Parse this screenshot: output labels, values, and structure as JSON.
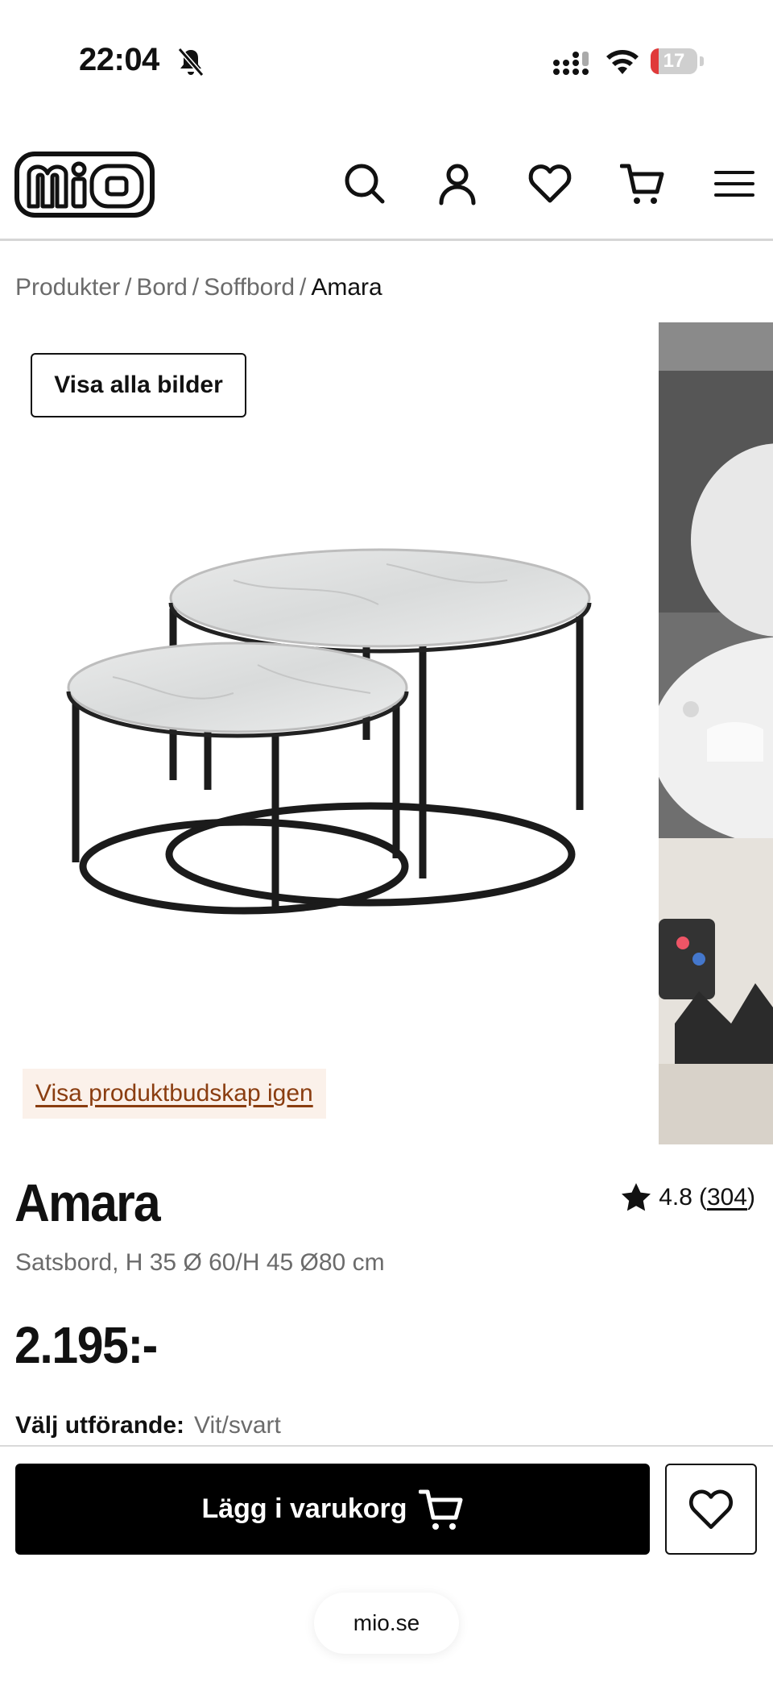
{
  "status_bar": {
    "time": "22:04",
    "battery_level": "17",
    "battery_color": "#e03a3a"
  },
  "header": {
    "logo_text": "mio",
    "icons": [
      "search-icon",
      "account-icon",
      "heart-icon",
      "cart-icon",
      "menu-icon"
    ]
  },
  "breadcrumb": {
    "items": [
      "Produkter",
      "Bord",
      "Soffbord"
    ],
    "current": "Amara",
    "separator": "/"
  },
  "gallery": {
    "show_all_label": "Visa alla bilder",
    "message_link": "Visa produktbudskap igen"
  },
  "product": {
    "title": "Amara",
    "rating": "4.8",
    "review_count": "304",
    "subtitle": "Satsbord, H 35 Ø 60/H 45 Ø80 cm",
    "price": "2.195:-",
    "variant_label": "Välj utförande:",
    "variant_value": "Vit/svart"
  },
  "actions": {
    "add_to_cart": "Lägg i varukorg"
  },
  "browser": {
    "url": "mio.se"
  }
}
